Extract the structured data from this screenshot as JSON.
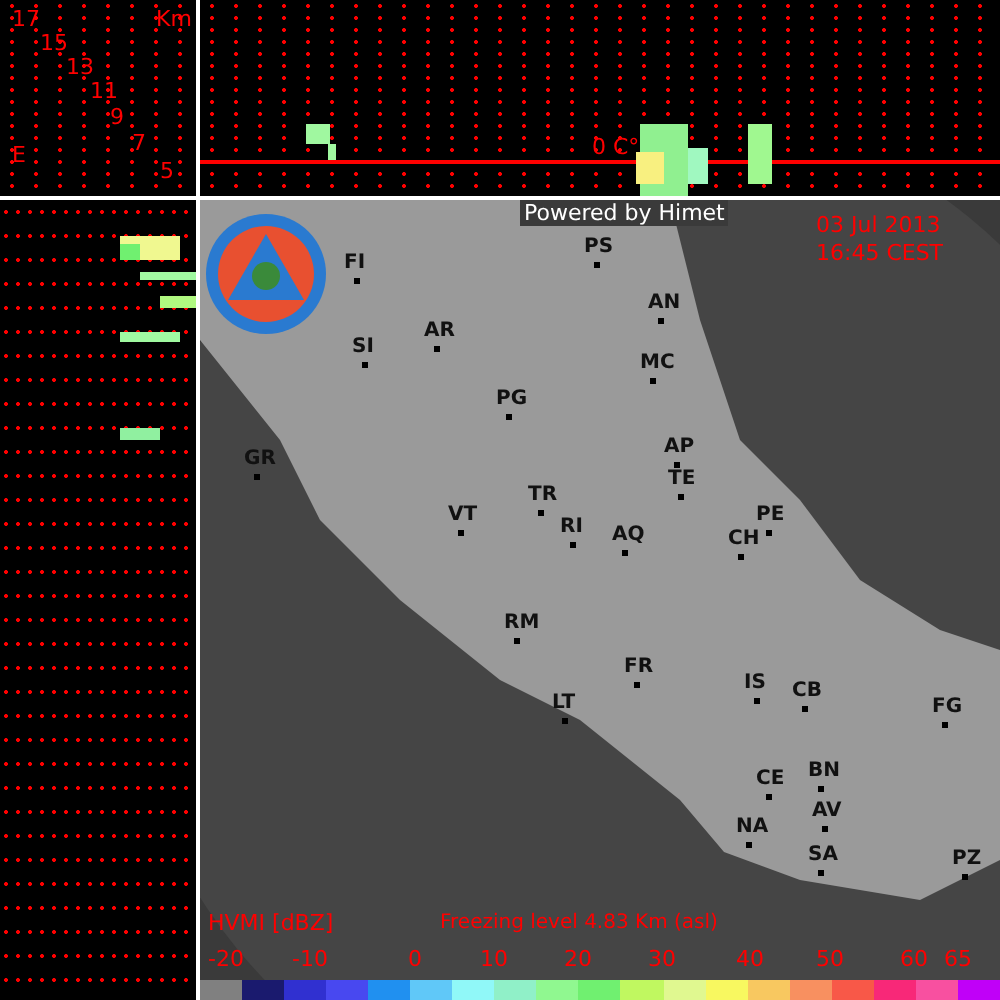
{
  "cross_section": {
    "unit": "Km",
    "heights": [
      "17",
      "15",
      "13",
      "11",
      "9",
      "7",
      "5"
    ],
    "axis_label": "E",
    "freezing_mark": "0 C°"
  },
  "map": {
    "credit": "Powered by Himet",
    "date": "03 Jul 2013",
    "time": "16:45 CEST",
    "cities": [
      {
        "name": "FI"
      },
      {
        "name": "PS"
      },
      {
        "name": "SI"
      },
      {
        "name": "AR"
      },
      {
        "name": "AN"
      },
      {
        "name": "MC"
      },
      {
        "name": "PG"
      },
      {
        "name": "AP"
      },
      {
        "name": "GR"
      },
      {
        "name": "TE"
      },
      {
        "name": "TR"
      },
      {
        "name": "VT"
      },
      {
        "name": "RI"
      },
      {
        "name": "PE"
      },
      {
        "name": "AQ"
      },
      {
        "name": "CH"
      },
      {
        "name": "RM"
      },
      {
        "name": "FR"
      },
      {
        "name": "IS"
      },
      {
        "name": "CB"
      },
      {
        "name": "FG"
      },
      {
        "name": "LT"
      },
      {
        "name": "CE"
      },
      {
        "name": "BN"
      },
      {
        "name": "AV"
      },
      {
        "name": "NA"
      },
      {
        "name": "SA"
      },
      {
        "name": "PZ"
      }
    ]
  },
  "legend": {
    "title": "HVMI [dBZ]",
    "freezing_level": "Freezing level  4.83 Km (asl)",
    "ticks": [
      "-20",
      "-10",
      "0",
      "10",
      "20",
      "30",
      "40",
      "50",
      "60",
      "65"
    ],
    "colors": [
      {
        "color": "#808080"
      },
      {
        "color": "#1a1a6e"
      },
      {
        "color": "#3030d0"
      },
      {
        "color": "#4848f0"
      },
      {
        "color": "#2090f0"
      },
      {
        "color": "#60c8f8"
      },
      {
        "color": "#90f8f8"
      },
      {
        "color": "#90f0c8"
      },
      {
        "color": "#90f890"
      },
      {
        "color": "#70f070"
      },
      {
        "color": "#c0f860"
      },
      {
        "color": "#e0f890"
      },
      {
        "color": "#f8f860"
      },
      {
        "color": "#f8c860"
      },
      {
        "color": "#f89060"
      },
      {
        "color": "#f85848"
      },
      {
        "color": "#f82878"
      },
      {
        "color": "#f850a0"
      },
      {
        "color": "#c000f8"
      }
    ]
  }
}
